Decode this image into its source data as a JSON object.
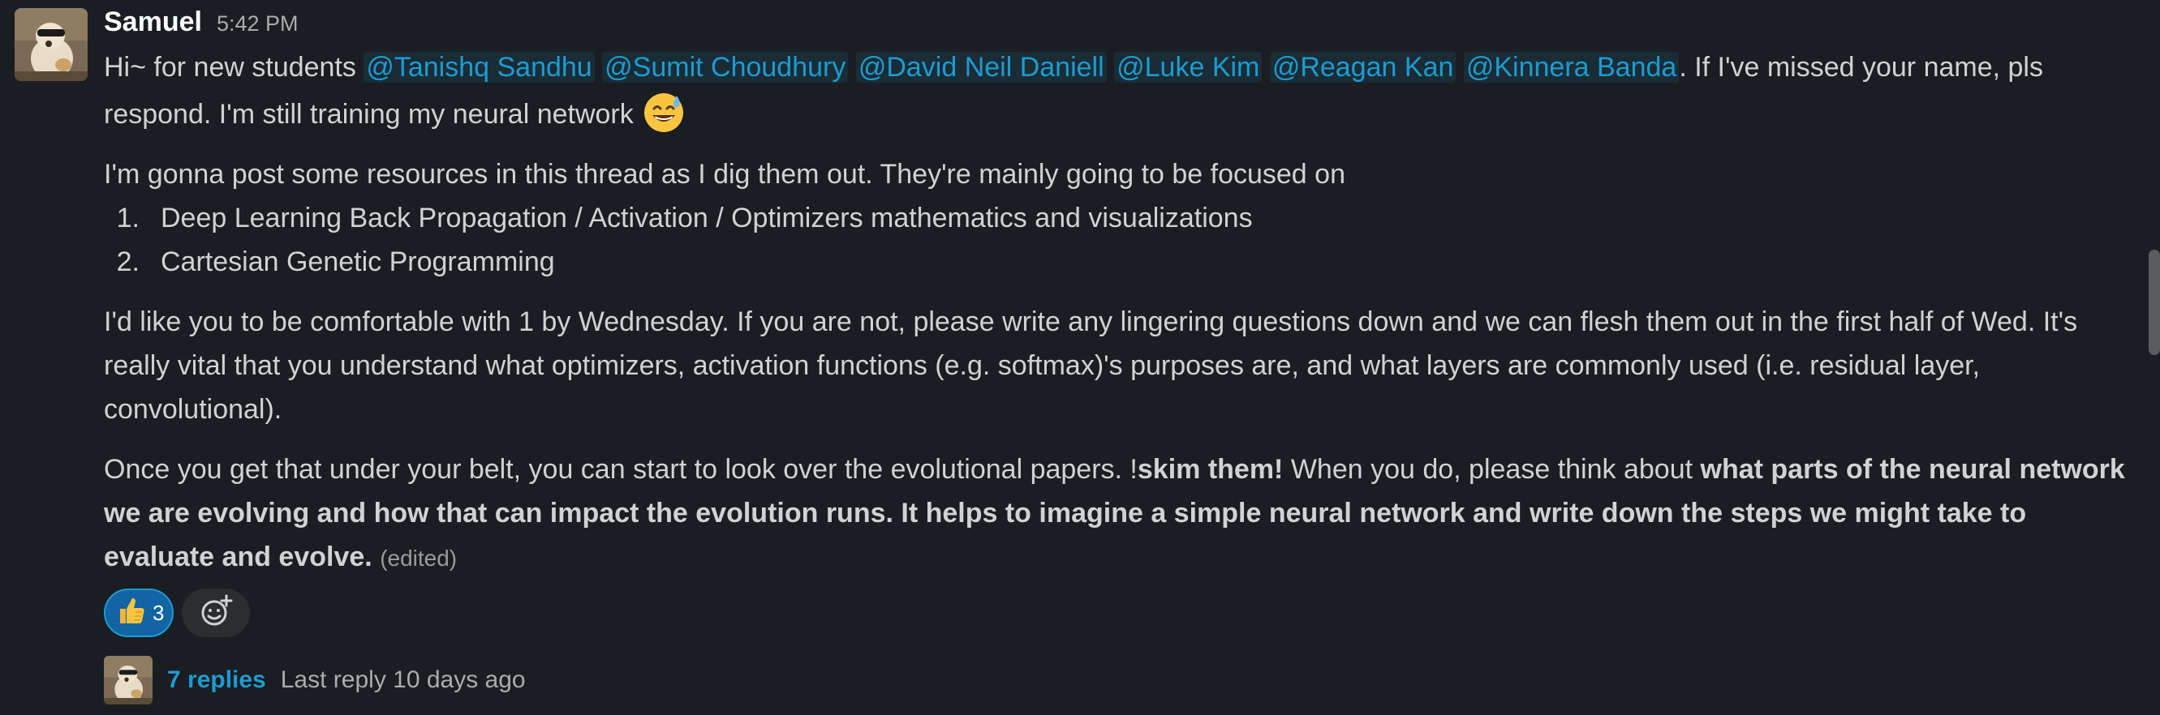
{
  "message": {
    "sender": "Samuel",
    "time": "5:42 PM",
    "p1": {
      "intro": "Hi~ for new students ",
      "mentions": [
        "@Tanishq Sandhu",
        "@Sumit Choudhury",
        "@David Neil Daniell",
        "@Luke Kim",
        "@Reagan Kan",
        "@Kinnera Banda"
      ],
      "after": ". If I've missed your name, pls respond. I'm still training my neural network ",
      "emoji": "sweat-smile-emoji"
    },
    "p2": "I'm gonna post some resources in this thread as I dig them out. They're mainly going to be focused on",
    "list": [
      {
        "num": "1.",
        "text": "Deep Learning Back Propagation / Activation / Optimizers mathematics and visualizations"
      },
      {
        "num": "2.",
        "text": "Cartesian Genetic Programming"
      }
    ],
    "p3": "I'd like you to be comfortable with 1 by Wednesday. If you are not, please write any lingering questions down and we can flesh them out in the first half of Wed. It's really vital that you understand what optimizers, activation functions (e.g. softmax)'s purposes are, and what layers are commonly used (i.e. residual layer, convolutional).",
    "p4": {
      "a": "Once you get that under your belt, you can start to look over the evolutional papers. !",
      "b": "skim them!",
      "c": " When you do, please think about ",
      "d": "what parts of the neural network we are evolving and how that can impact the evolution runs. It helps to imagine a simple neural network and write down the steps we might take to evaluate and evolve.",
      "edited": "(edited)"
    }
  },
  "reactions": [
    {
      "icon": "thumbs-up-icon",
      "count": "3"
    }
  ],
  "add_reaction_icon": "add-reaction-icon",
  "thread": {
    "replies": "7 replies",
    "last_reply": "Last reply 10 days ago"
  },
  "colors": {
    "background": "#1a1d21",
    "mention": "#1d9bd1",
    "reaction_bg": "#1264a3"
  }
}
